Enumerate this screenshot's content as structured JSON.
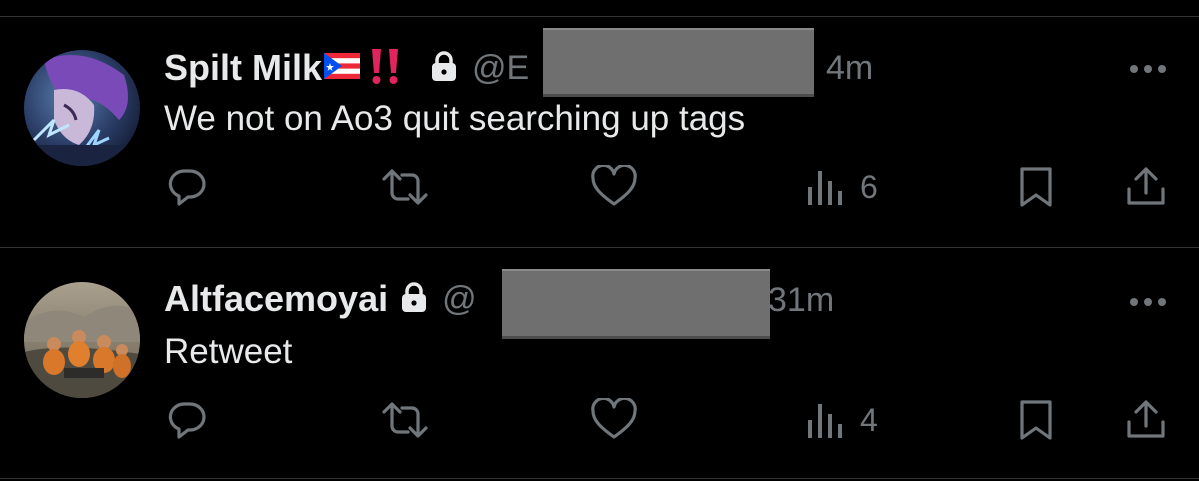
{
  "colors": {
    "background": "#000000",
    "primary_text": "#e7e9ea",
    "secondary_text": "#71767b",
    "divider": "#2f3336",
    "redaction": "#6f6f6f",
    "bang": "#e0245e"
  },
  "tweets": [
    {
      "display_name": "Spilt Milk",
      "flag_icon": "puerto-rico-flag-icon",
      "bang_icon": "double-exclamation-icon",
      "lock_icon": "lock-icon",
      "handle_prefix": "@E",
      "time": "4m",
      "text": "We not on Ao3 quit searching up tags",
      "views": "6",
      "more_icon": "more-icon"
    },
    {
      "display_name": "Altfacemoyai",
      "lock_icon": "lock-icon",
      "handle_prefix": "@",
      "time": "31m",
      "text": "Retweet",
      "views": "4",
      "more_icon": "more-icon"
    }
  ]
}
